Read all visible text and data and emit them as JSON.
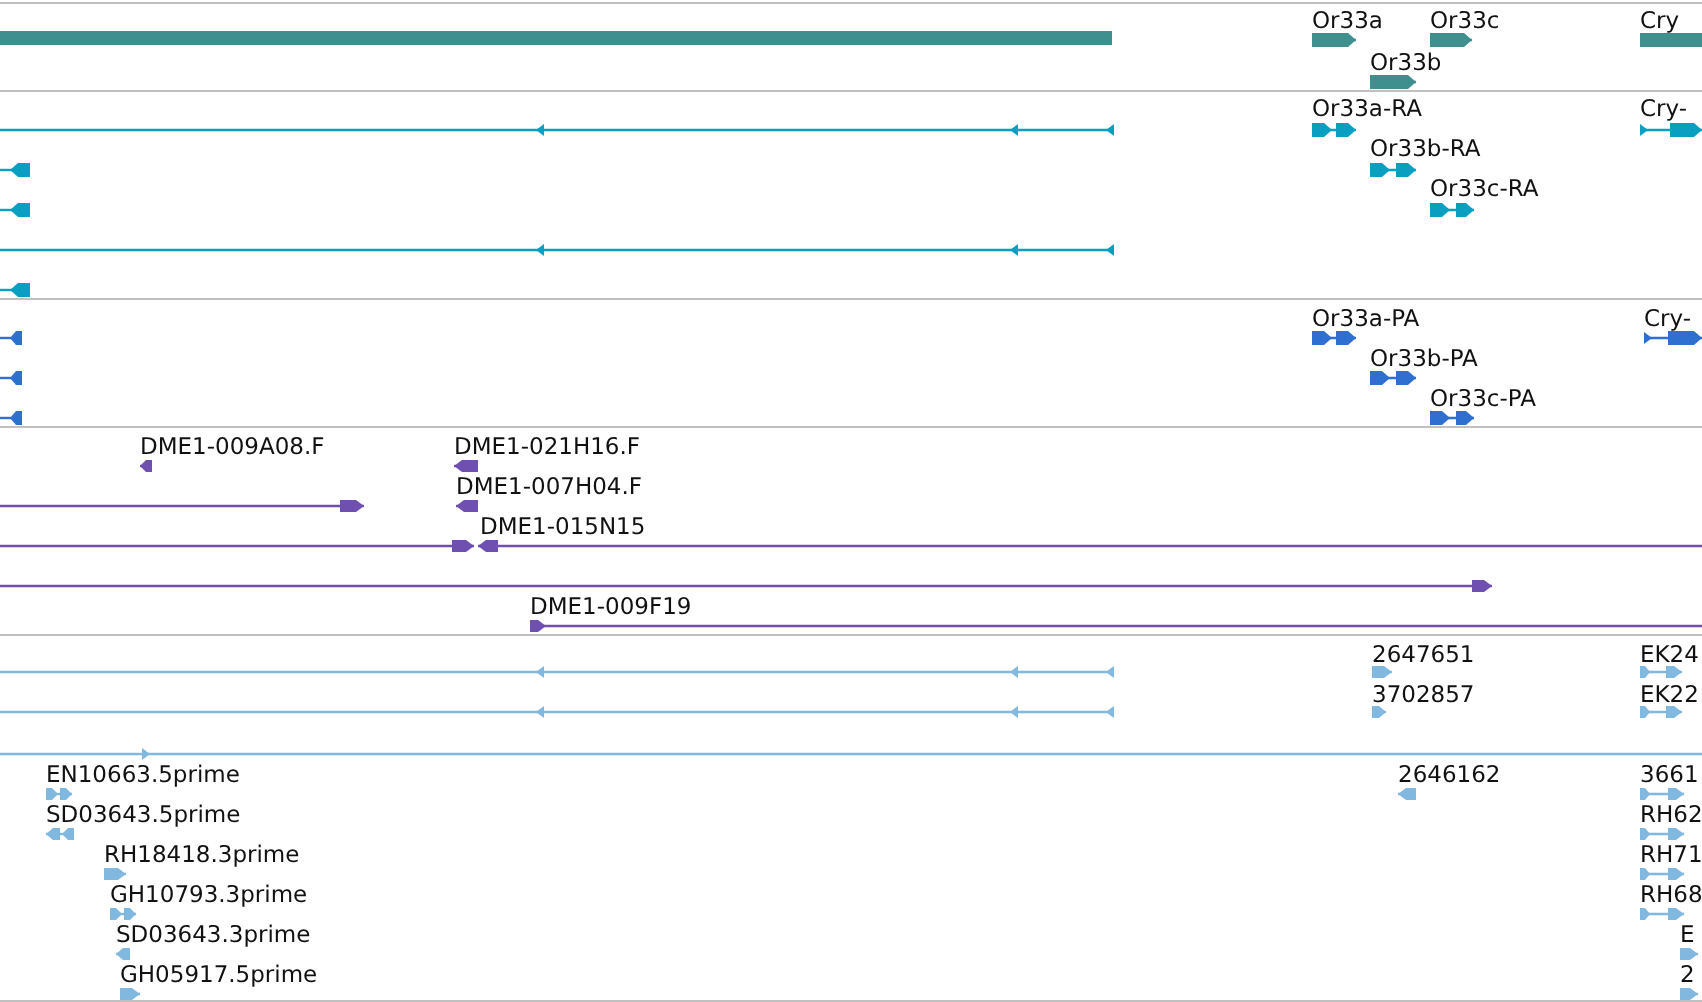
{
  "tracks": [
    {
      "color": "#3f8f8f",
      "features": [
        {
          "kind": "gene"
        },
        {
          "kind": "gene",
          "reverse": false,
          "label": "Or33a"
        },
        {
          "kind": "gene",
          "reverse": false,
          "label": "Or33c"
        },
        {
          "kind": "gene",
          "label": "Cry"
        },
        {
          "kind": "gene",
          "reverse": false,
          "label": "Or33b"
        }
      ]
    },
    {
      "color": "#0a9fc0",
      "features": [
        {
          "kind": "transcript",
          "reverse": true
        },
        {
          "kind": "transcript",
          "reverse": false,
          "label": "Or33a-RA"
        },
        {
          "kind": "transcript",
          "reverse": false,
          "label": "Cry-"
        },
        {
          "kind": "transcript",
          "reverse": true
        },
        {
          "kind": "transcript",
          "reverse": false,
          "label": "Or33b-RA"
        },
        {
          "kind": "transcript",
          "reverse": true
        },
        {
          "kind": "transcript",
          "reverse": false,
          "label": "Or33c-RA"
        },
        {
          "kind": "transcript",
          "reverse": true
        },
        {
          "kind": "transcript",
          "reverse": true
        }
      ]
    },
    {
      "color": "#2f6fd0",
      "features": [
        {
          "kind": "transcript",
          "reverse": true
        },
        {
          "kind": "transcript",
          "reverse": false,
          "label": "Or33a-PA"
        },
        {
          "kind": "transcript",
          "reverse": false,
          "label": "Cry-"
        },
        {
          "kind": "transcript",
          "reverse": true
        },
        {
          "kind": "transcript",
          "reverse": false,
          "label": "Or33b-PA"
        },
        {
          "kind": "transcript",
          "reverse": true
        },
        {
          "kind": "transcript",
          "reverse": false,
          "label": "Or33c-PA"
        }
      ]
    },
    {
      "color": "#6f50b0",
      "features": [
        {
          "kind": "read",
          "reverse": true,
          "label": "DME1-009A08.F"
        },
        {
          "kind": "read",
          "reverse": true,
          "label": "DME1-021H16.F"
        },
        {
          "kind": "read",
          "reverse": false
        },
        {
          "kind": "read",
          "reverse": true,
          "label": "DME1-007H04.F"
        },
        {
          "kind": "read",
          "reverse": false
        },
        {
          "kind": "read",
          "reverse": true,
          "label": "DME1-015N15"
        },
        {
          "kind": "read",
          "reverse": false
        },
        {
          "kind": "read",
          "reverse": false,
          "label": "DME1-009F19"
        }
      ]
    },
    {
      "color": "#80b8e0",
      "features": [
        {
          "kind": "read",
          "reverse": true
        },
        {
          "kind": "read",
          "reverse": false,
          "label": "2647651"
        },
        {
          "kind": "read",
          "reverse": false,
          "label": "EK24"
        },
        {
          "kind": "read",
          "reverse": true
        },
        {
          "kind": "read",
          "reverse": false,
          "label": "3702857"
        },
        {
          "kind": "read",
          "reverse": false,
          "label": "EK22"
        },
        {
          "kind": "read",
          "reverse": false
        },
        {
          "kind": "read",
          "reverse": false,
          "label": "EN10663.5prime"
        },
        {
          "kind": "read",
          "reverse": true,
          "label": "2646162"
        },
        {
          "kind": "read",
          "reverse": false,
          "label": "3661"
        },
        {
          "kind": "read",
          "reverse": true,
          "label": "SD03643.5prime"
        },
        {
          "kind": "read",
          "reverse": false,
          "label": "RH62"
        },
        {
          "kind": "read",
          "reverse": false,
          "label": "RH18418.3prime"
        },
        {
          "kind": "read",
          "reverse": false,
          "label": "RH71"
        },
        {
          "kind": "read",
          "reverse": false,
          "label": "GH10793.3prime"
        },
        {
          "kind": "read",
          "reverse": false,
          "label": "RH68"
        },
        {
          "kind": "read",
          "reverse": true,
          "label": "SD03643.3prime"
        },
        {
          "kind": "read",
          "reverse": false,
          "label": "E"
        },
        {
          "kind": "read",
          "reverse": false,
          "label": "GH05917.5prime"
        },
        {
          "kind": "read",
          "reverse": false,
          "label": "2"
        }
      ]
    }
  ]
}
